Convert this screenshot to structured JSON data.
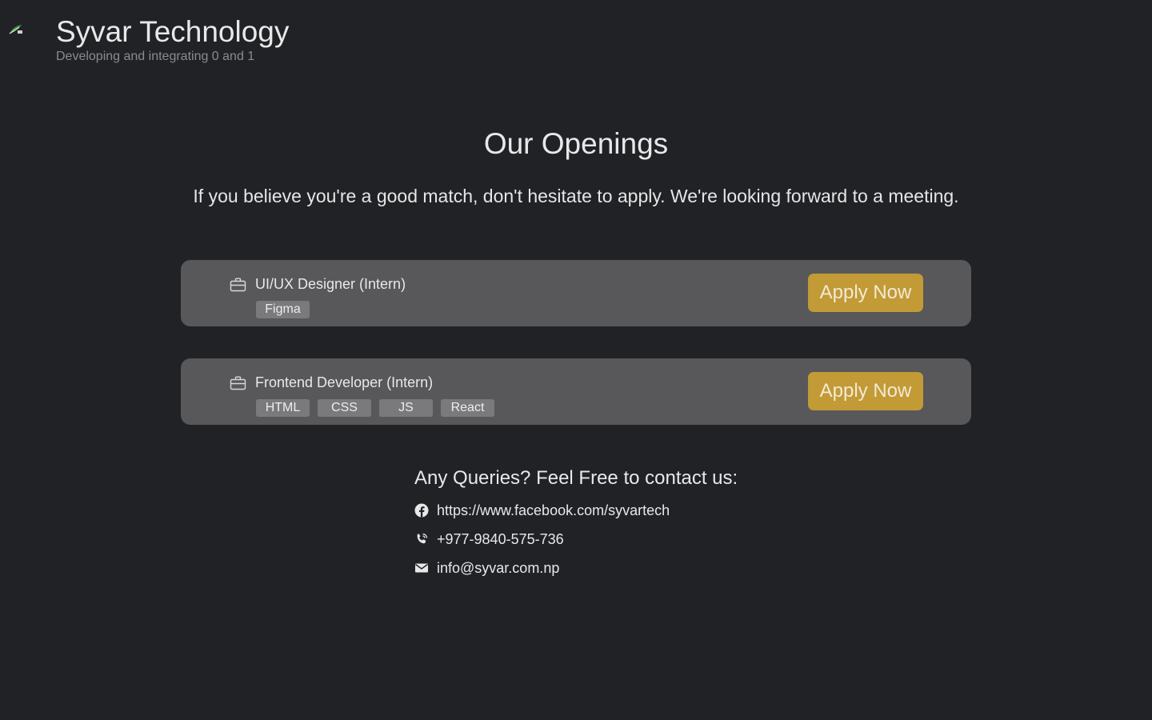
{
  "header": {
    "title": "Syvar Technology",
    "tagline": "Developing and integrating 0 and 1",
    "logo_icon": "leaf-logo-icon"
  },
  "openings": {
    "title": "Our Openings",
    "subtitle": "If you believe you're a good match, don't hesitate to apply. We're looking forward to a meeting.",
    "jobs": [
      {
        "title": "UI/UX Designer (Intern)",
        "icon": "briefcase-icon",
        "tags": [
          "Figma"
        ],
        "apply_label": "Apply Now"
      },
      {
        "title": "Frontend Developer (Intern)",
        "icon": "briefcase-icon",
        "tags": [
          "HTML",
          "CSS",
          "JS",
          "React"
        ],
        "apply_label": "Apply Now"
      }
    ]
  },
  "contact": {
    "heading": "Any Queries? Feel Free to contact us:",
    "items": [
      {
        "icon": "facebook-icon",
        "text": "https://www.facebook.com/syvartech"
      },
      {
        "icon": "phone-icon",
        "text": "+977-9840-575-736"
      },
      {
        "icon": "mail-icon",
        "text": "info@syvar.com.np"
      }
    ]
  },
  "colors": {
    "background": "#212226",
    "card": "#58585a",
    "tag": "#7a7a7d",
    "accent": "#c29a36",
    "muted_text": "#8a8b8e"
  }
}
